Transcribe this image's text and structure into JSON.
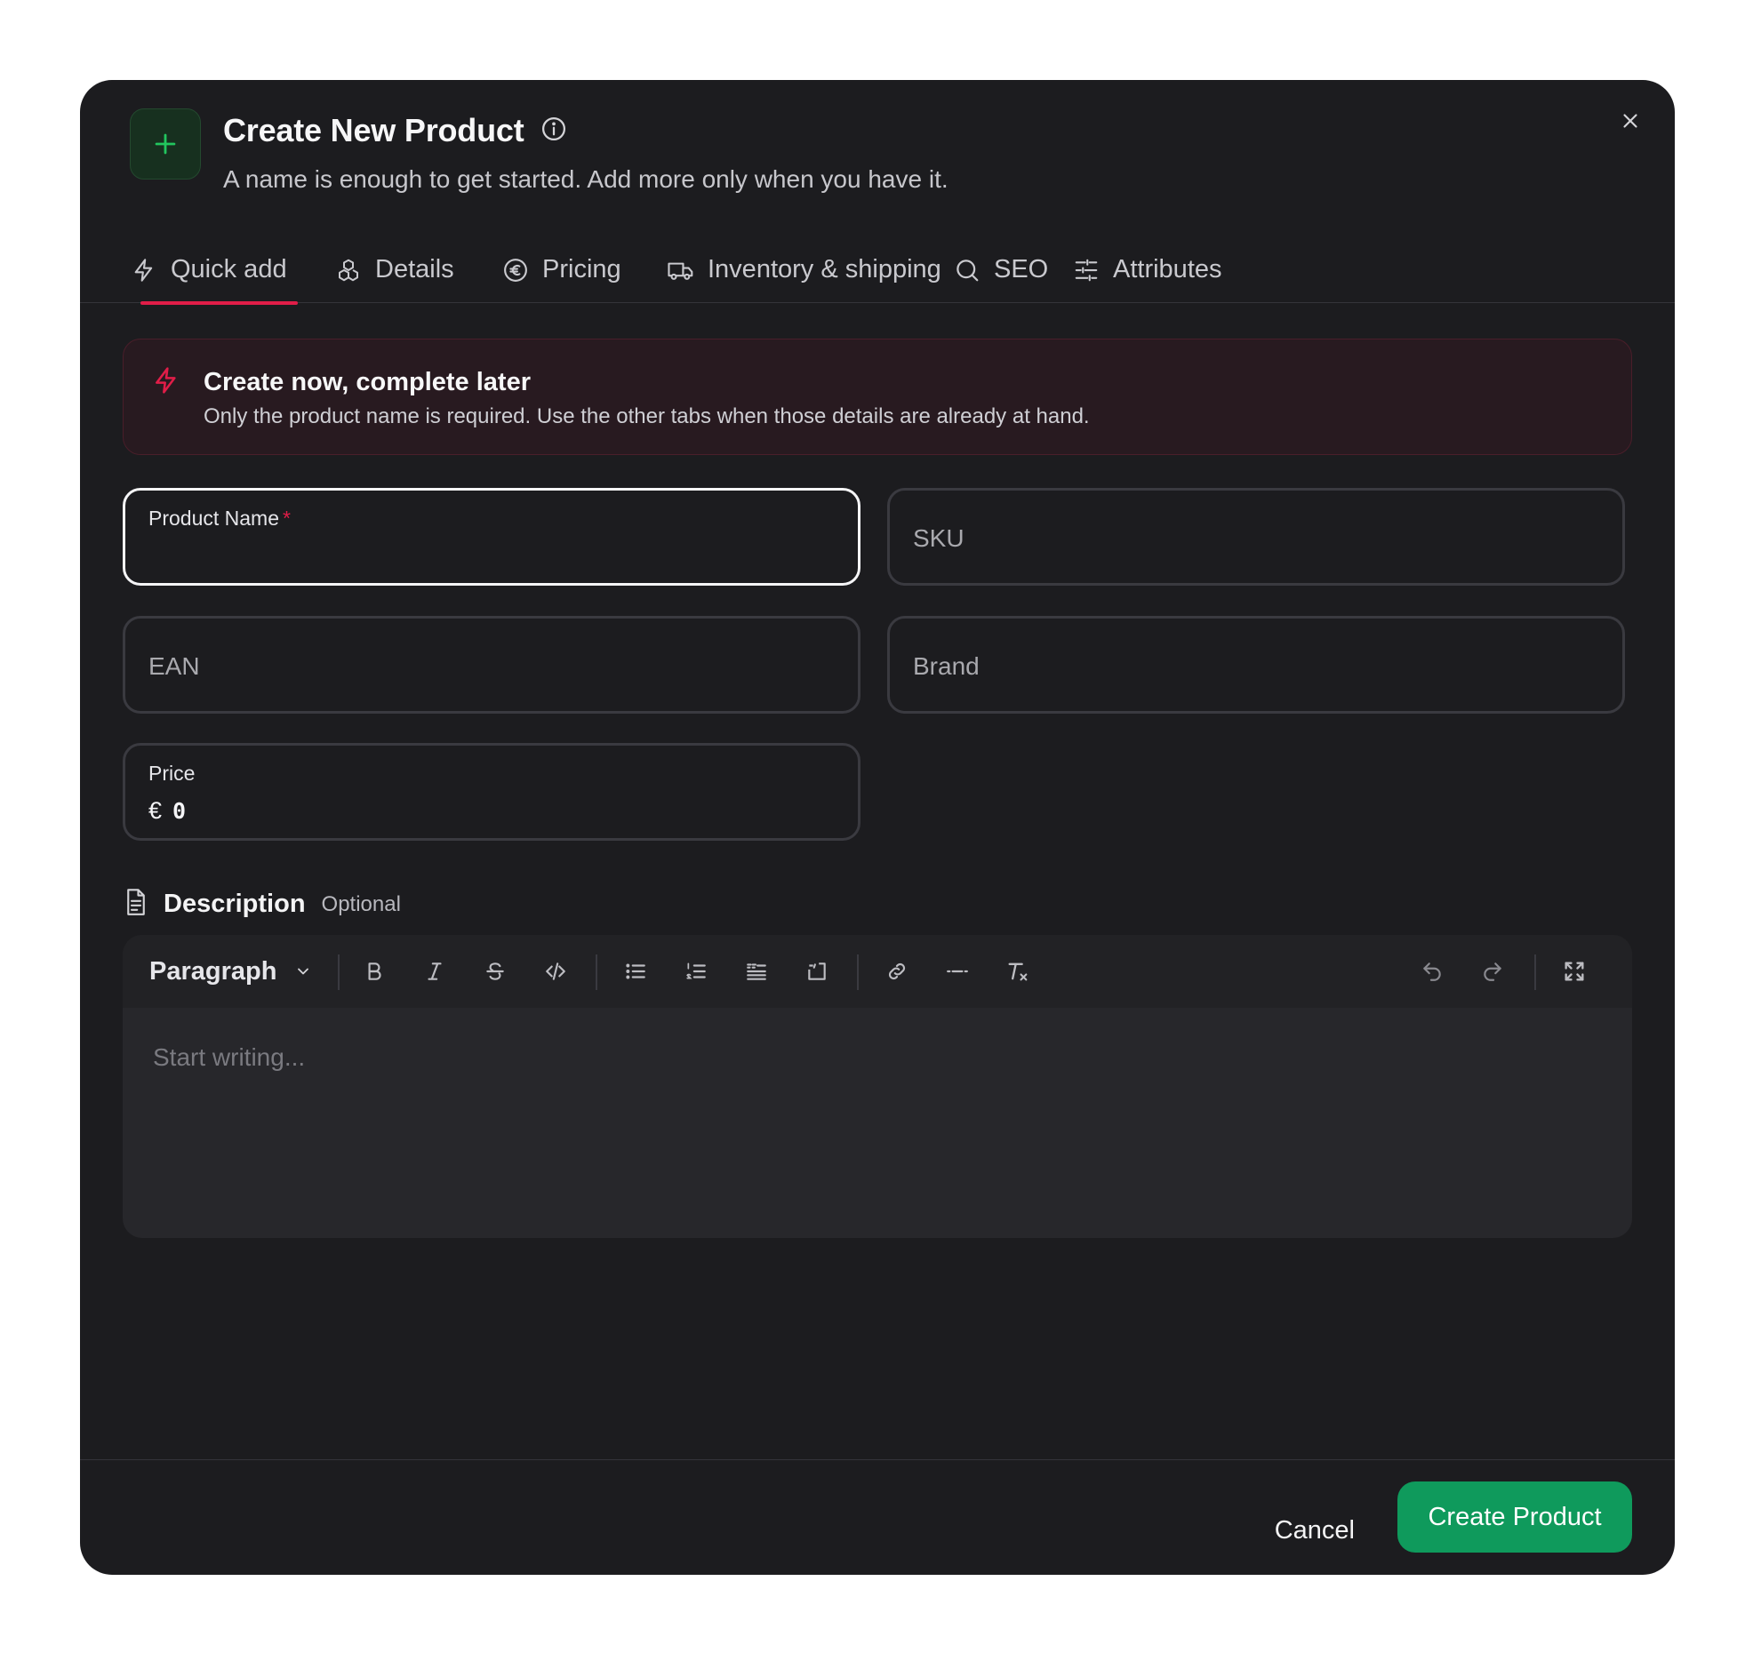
{
  "dialog": {
    "title": "Create New Product",
    "subtitle": "A name is enough to get started. Add more only when you have it.",
    "close_icon": "close-icon",
    "info_icon": "info-icon",
    "badge_icon": "plus-icon"
  },
  "tabs": [
    {
      "label": "Quick add",
      "icon": "lightning-icon",
      "active": true
    },
    {
      "label": "Details",
      "icon": "boxes-icon",
      "active": false
    },
    {
      "label": "Pricing",
      "icon": "euro-circle-icon",
      "active": false
    },
    {
      "label": "Inventory & shipping",
      "icon": "truck-icon",
      "active": false
    },
    {
      "label": "SEO",
      "icon": "search-icon",
      "active": false
    },
    {
      "label": "Attributes",
      "icon": "sliders-icon",
      "active": false
    }
  ],
  "alert": {
    "title": "Create now, complete later",
    "text": "Only the product name is required. Use the other tabs when those details are already at hand.",
    "icon": "lightning-icon"
  },
  "fields": {
    "product_name": {
      "label": "Product Name",
      "required_mark": "*",
      "value": ""
    },
    "sku": {
      "placeholder": "SKU"
    },
    "ean": {
      "placeholder": "EAN"
    },
    "brand": {
      "placeholder": "Brand"
    },
    "price": {
      "label": "Price",
      "currency": "€",
      "value": "0"
    }
  },
  "description": {
    "title": "Description",
    "optional": "Optional",
    "icon": "document-icon",
    "block_type": "Paragraph",
    "placeholder": "Start writing..."
  },
  "toolbar_icons": [
    "bold-icon",
    "italic-icon",
    "strikethrough-icon",
    "code-icon",
    "bullet-list-icon",
    "ordered-list-icon",
    "blockquote-icon",
    "code-block-icon",
    "link-icon",
    "horizontal-rule-icon",
    "clear-format-icon",
    "undo-icon",
    "redo-icon",
    "fullscreen-icon"
  ],
  "footer": {
    "cancel_label": "Cancel",
    "create_label": "Create Product"
  },
  "colors": {
    "accent": "#e11d48",
    "primary": "#0f9a5c",
    "background": "#1c1c1f"
  }
}
